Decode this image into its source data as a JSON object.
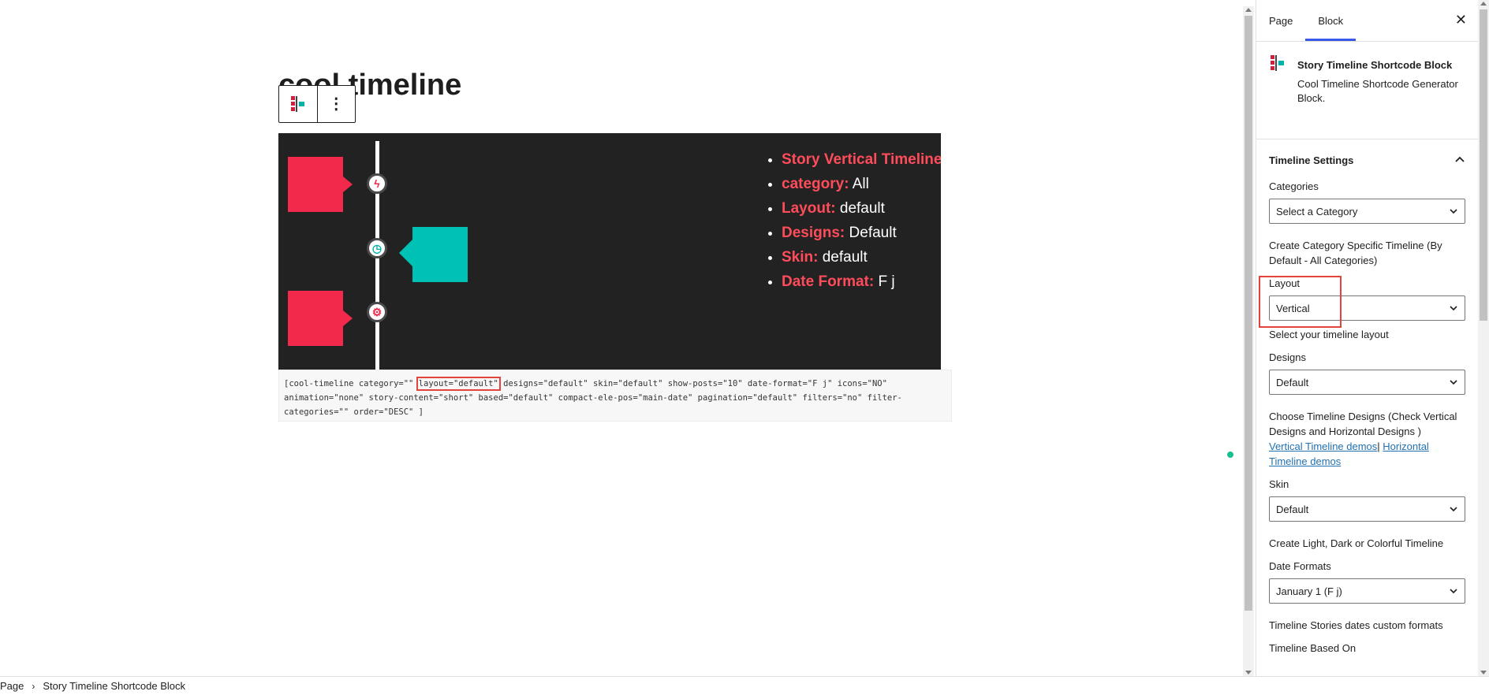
{
  "editor": {
    "page_title": "cool timeline",
    "toolbar": {
      "more_label": "⋮"
    }
  },
  "preview": {
    "items": [
      {
        "key": "Story Vertical Timeline",
        "value": ""
      },
      {
        "key": "category:",
        "value": " All"
      },
      {
        "key": "Layout:",
        "value": " default"
      },
      {
        "key": "Designs:",
        "value": " Default"
      },
      {
        "key": "Skin:",
        "value": " default"
      },
      {
        "key": "Date Format:",
        "value": " F j"
      }
    ],
    "colors": {
      "red": "#f2294a",
      "teal": "#00c1b5",
      "background": "#222222"
    },
    "icons": [
      "bolt-icon",
      "clock-icon",
      "gear-icon"
    ]
  },
  "shortcode": {
    "before": "[cool-timeline category=\"\" ",
    "highlight": "layout=\"default\"",
    "after": " designs=\"default\" skin=\"default\" show-posts=\"10\" date-format=\"F j\" icons=\"NO\" animation=\"none\" story-content=\"short\" based=\"default\" compact-ele-pos=\"main-date\" pagination=\"default\" filters=\"no\" filter-categories=\"\" order=\"DESC\" ]"
  },
  "breadcrumb": {
    "page": "Page",
    "sep": "›",
    "block": "Story Timeline Shortcode Block"
  },
  "sidebar": {
    "tabs": {
      "page": "Page",
      "block": "Block"
    },
    "close": "✕",
    "block_title": "Story Timeline Shortcode Block",
    "block_desc": "Cool Timeline Shortcode Generator Block.",
    "panel_title": "Timeline Settings",
    "categories": {
      "label": "Categories",
      "value": "Select a Category",
      "help": "Create Category Specific Timeline (By Default - All Categories)"
    },
    "layout": {
      "label": "Layout",
      "value": "Vertical",
      "help": "Select your timeline layout"
    },
    "designs": {
      "label": "Designs",
      "value": "Default",
      "help": "Choose Timeline Designs (Check Vertical Designs and Horizontal Designs )",
      "link1": "Vertical Timeline demos",
      "sep": "|",
      "link2": "Horizontal Timeline demos"
    },
    "skin": {
      "label": "Skin",
      "value": "Default",
      "help": "Create Light, Dark or Colorful Timeline"
    },
    "date_formats": {
      "label": "Date Formats",
      "value": "January 1 (F j)",
      "help": "Timeline Stories dates custom formats"
    },
    "based_on": {
      "label": "Timeline Based On"
    }
  }
}
